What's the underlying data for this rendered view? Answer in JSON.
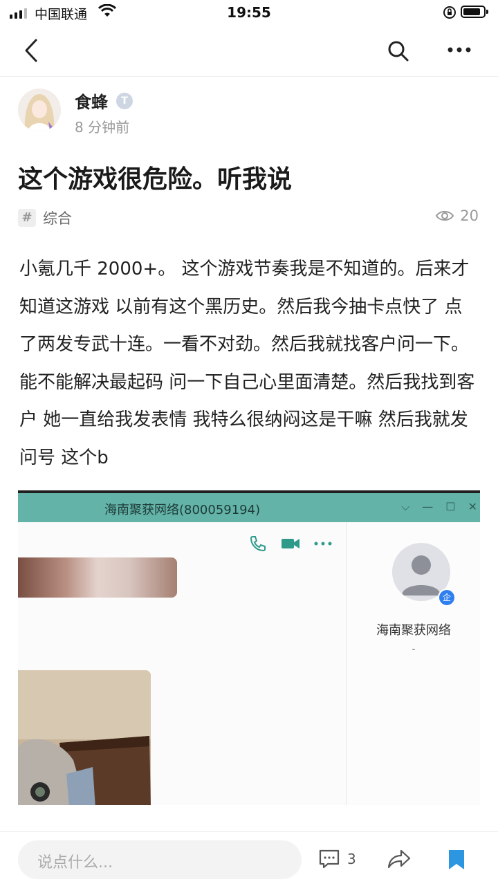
{
  "status_bar": {
    "carrier": "中国联通",
    "time": "19:55"
  },
  "post": {
    "author_name": "食蜂",
    "author_badge": "T",
    "time_ago": "8 分钟前",
    "title": "这个游戏很危险。听我说",
    "tag": "综合",
    "views": "20",
    "body": "小氪几千 2000+。 这个游戏节奏我是不知道的。后来才知道这游戏 以前有这个黑历史。然后我今抽卡点快了 点了两发专武十连。一看不对劲。然后我就找客户问一下。能不能解决最起码 问一下自己心里面清楚。然后我找到客户 她一直给我发表情 我特么很纳闷这是干嘛 然后我就发问号 这个b"
  },
  "screenshot": {
    "window_title": "海南聚获网络(800059194)",
    "contact_name": "海南聚获网络",
    "contact_badge": "企",
    "contact_sub": "-"
  },
  "bottom_bar": {
    "comment_placeholder": "说点什么...",
    "comment_count": "3"
  },
  "colors": {
    "accent": "#2c97e0",
    "screenshot_bar": "#63b3a8"
  }
}
